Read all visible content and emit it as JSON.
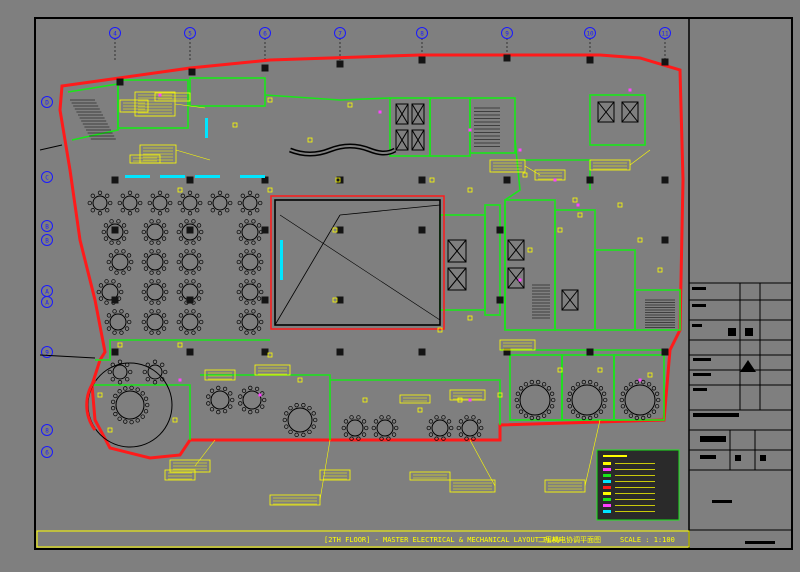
{
  "drawing": {
    "title_line": "[2TH FLOOR] - MASTER ELECTRICAL & MECHANICAL LAYOUT PLAN",
    "title_cn": "二层机电协调平面图",
    "scale_text": "SCALE : 1:100"
  },
  "grid": {
    "columns": [
      "4",
      "5",
      "6",
      "7",
      "8",
      "9",
      "10",
      "11"
    ],
    "rows": [
      "D",
      "C",
      "B",
      "B",
      "A",
      "A",
      "9",
      "8",
      "6"
    ]
  },
  "colors": {
    "background": "#7f7f7f",
    "frame": "#000000",
    "wall": "#ff1a1a",
    "green": "#19e619",
    "yellow": "#ffff00",
    "cyan": "#00e5ff",
    "magenta": "#ff40ff",
    "dark": "#141414",
    "blue": "#1a1aff"
  }
}
